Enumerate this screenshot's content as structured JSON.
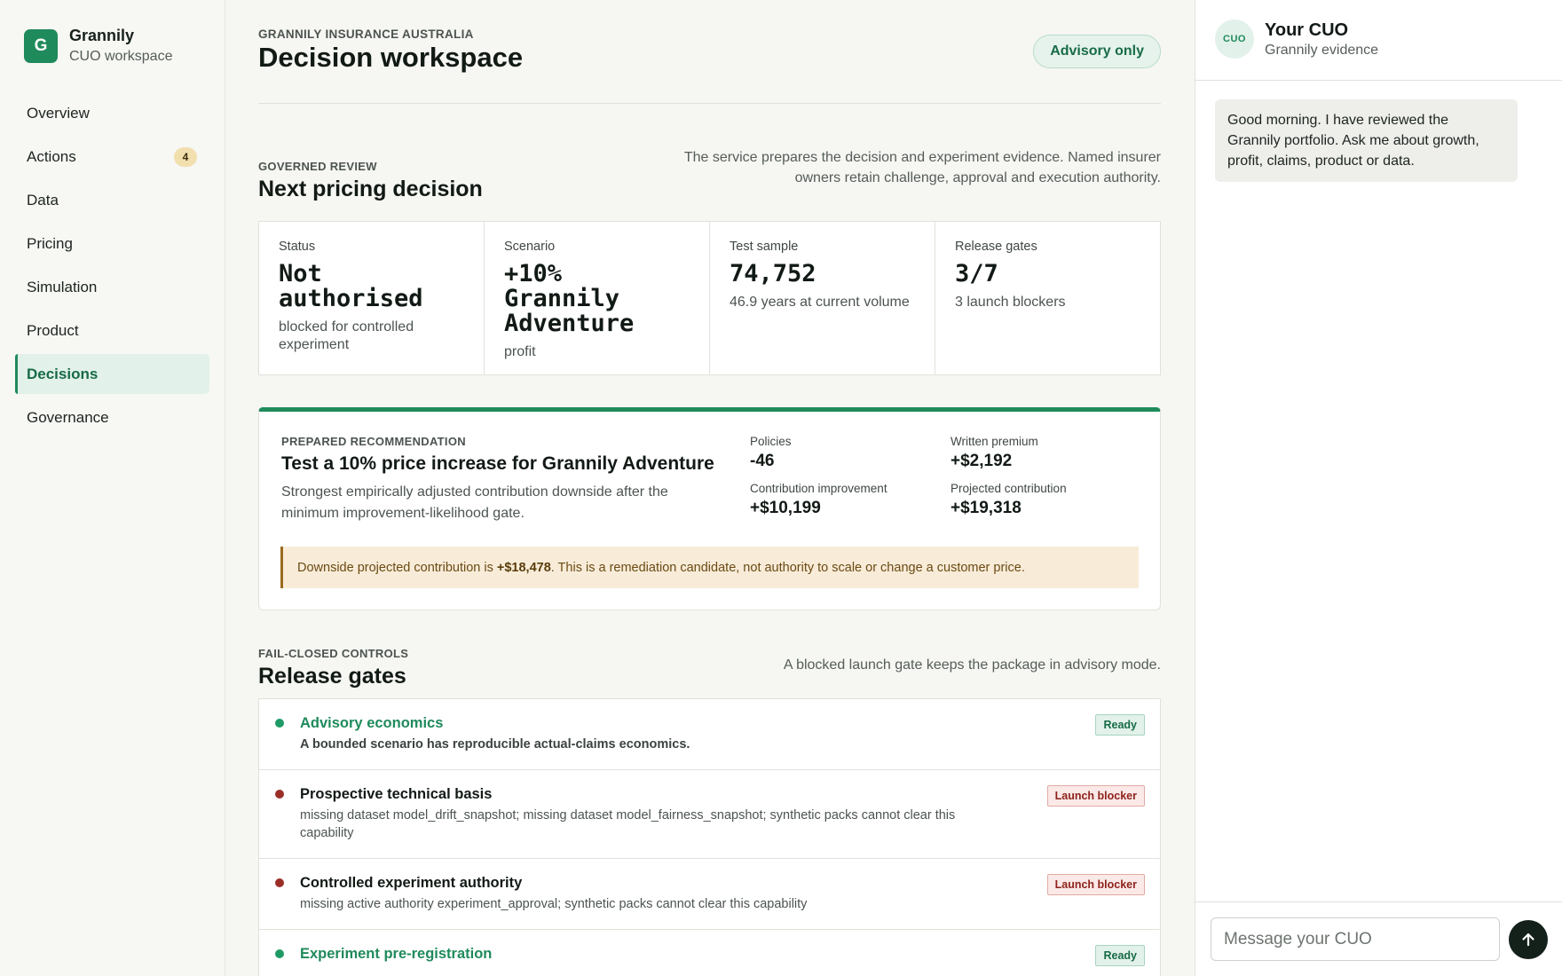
{
  "sidebar": {
    "logo_letter": "G",
    "brand_name": "Grannily",
    "brand_sub": "CUO workspace",
    "items": [
      {
        "label": "Overview"
      },
      {
        "label": "Actions",
        "badge": "4"
      },
      {
        "label": "Data"
      },
      {
        "label": "Pricing"
      },
      {
        "label": "Simulation"
      },
      {
        "label": "Product"
      },
      {
        "label": "Decisions",
        "active": true
      },
      {
        "label": "Governance"
      }
    ]
  },
  "header": {
    "org": "GRANNILY INSURANCE AUSTRALIA",
    "title": "Decision workspace",
    "pill": "Advisory only"
  },
  "review": {
    "eyebrow": "GOVERNED REVIEW",
    "title": "Next pricing decision",
    "note": "The service prepares the decision and experiment evidence. Named insurer owners retain challenge, approval and execution authority.",
    "metrics": [
      {
        "label": "Status",
        "value": "Not authorised",
        "sub": "blocked for controlled experiment"
      },
      {
        "label": "Scenario",
        "value": "+10% Grannily Adventure",
        "sub": "profit"
      },
      {
        "label": "Test sample",
        "value": "74,752",
        "sub": "46.9 years at current volume"
      },
      {
        "label": "Release gates",
        "value": "3/7",
        "sub": "3 launch blockers"
      }
    ]
  },
  "recommendation": {
    "eyebrow": "PREPARED RECOMMENDATION",
    "title": "Test a 10% price increase for Grannily Adventure",
    "desc": "Strongest empirically adjusted contribution downside after the minimum improvement-likelihood gate.",
    "stats": [
      {
        "label": "Policies",
        "value": "-46"
      },
      {
        "label": "Written premium",
        "value": "+$2,192"
      },
      {
        "label": "Contribution improvement",
        "value": "+$10,199"
      },
      {
        "label": "Projected contribution",
        "value": "+$19,318"
      }
    ],
    "warning_pre": "Downside projected contribution is ",
    "warning_value": "+$18,478",
    "warning_post": ". This is a remediation candidate, not authority to scale or change a customer price."
  },
  "gates": {
    "eyebrow": "FAIL-CLOSED CONTROLS",
    "title": "Release gates",
    "note": "A blocked launch gate keeps the package in advisory mode.",
    "items": [
      {
        "title": "Advisory economics",
        "desc": "A bounded scenario has reproducible actual-claims economics.",
        "status": "Ready"
      },
      {
        "title": "Prospective technical basis",
        "desc": "missing dataset model_drift_snapshot; missing dataset model_fairness_snapshot; synthetic packs cannot clear this capability",
        "status": "Launch blocker"
      },
      {
        "title": "Controlled experiment authority",
        "desc": "missing active authority experiment_approval; synthetic packs cannot clear this capability",
        "status": "Launch blocker"
      },
      {
        "title": "Experiment pre-registration",
        "desc": "",
        "status": "Ready"
      }
    ]
  },
  "chat": {
    "avatar": "CUO",
    "name": "Your CUO",
    "sub": "Grannily evidence",
    "message": "Good morning. I have reviewed the Grannily portfolio. Ask me about growth, profit, claims, product or data.",
    "placeholder": "Message your CUO"
  },
  "colors": {
    "accent": "#1f8a5b",
    "blocker": "#9b2f28",
    "warning_bg": "#f8ecd9"
  }
}
